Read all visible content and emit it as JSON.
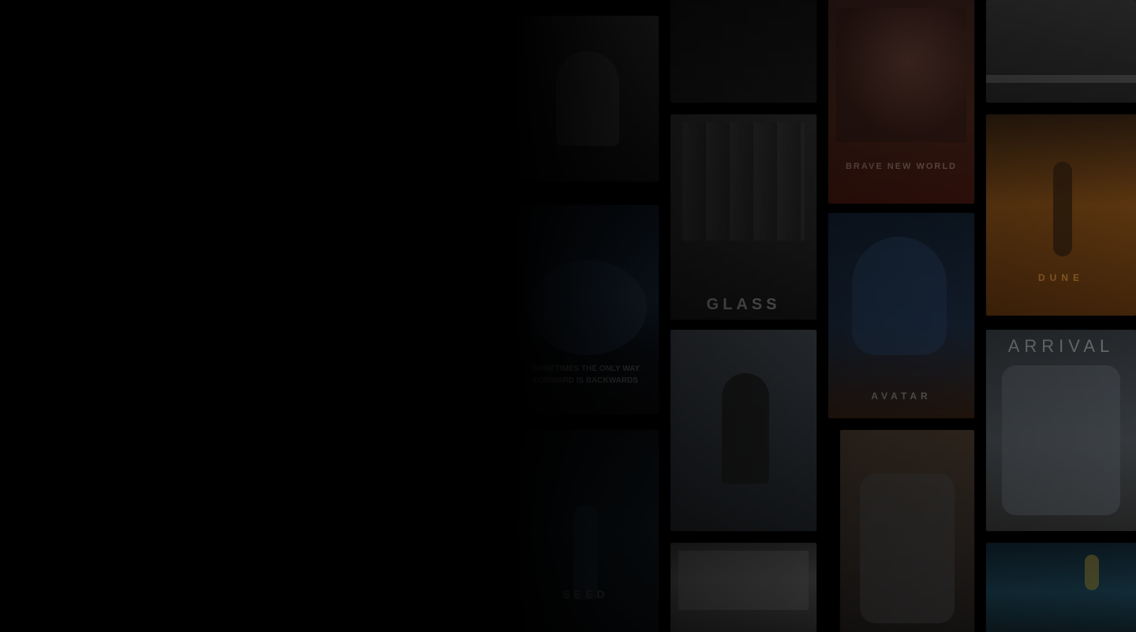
{
  "posters": {
    "glass": {
      "title": "GLASS"
    },
    "unknown_a": {
      "tagline": "SOMETIMES THE ONLY WAY FORWARD IS BACKWARDS"
    },
    "unknown_b": {
      "title": "BRAVE NEW WORLD"
    },
    "avatar": {
      "title": "AVATAR"
    },
    "arrival": {
      "title": "ARRIVAL"
    },
    "seed": {
      "title": "SEED"
    },
    "dune": {
      "title": "DUNE"
    }
  },
  "colors": {
    "background": "#000000"
  }
}
